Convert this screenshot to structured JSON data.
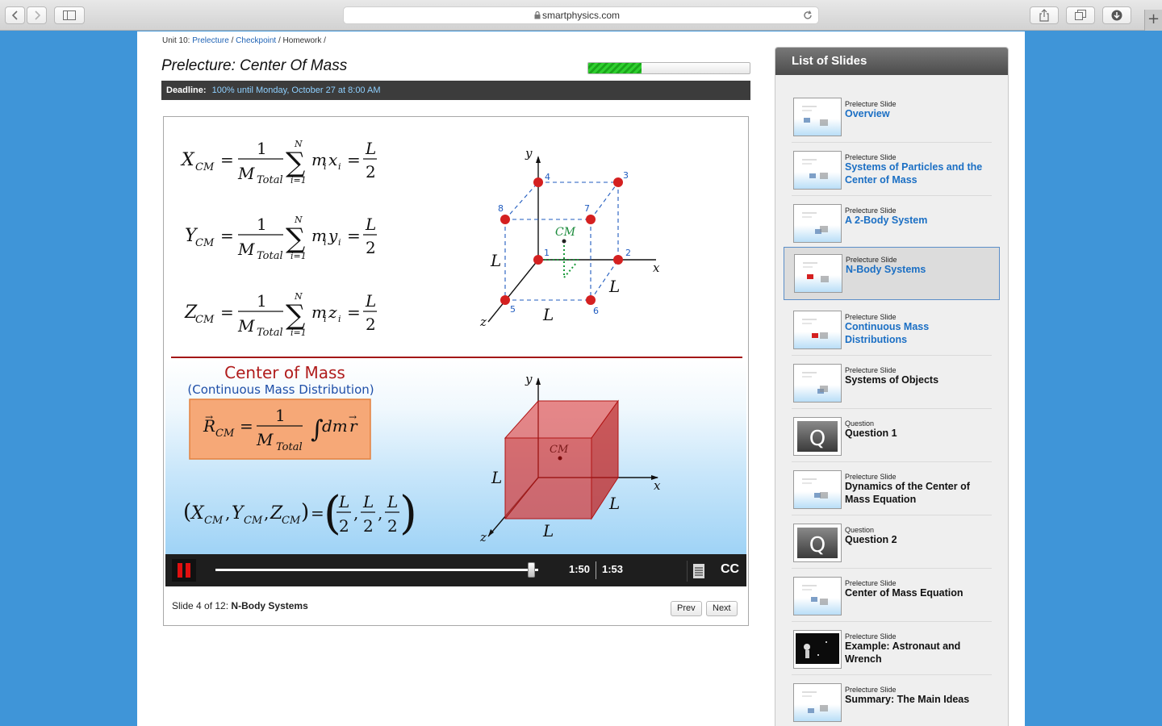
{
  "browser": {
    "url": "smartphysics.com"
  },
  "breadcrumb": {
    "unit": "Unit 10:",
    "prelecture": "Prelecture",
    "checkpoint": "Checkpoint",
    "homework": "Homework /",
    "sep": "/"
  },
  "page": {
    "title": "Prelecture: Center Of Mass",
    "progress_fraction": 0.33,
    "deadline_label": "Deadline:",
    "deadline_value": "100% until Monday, October 27 at 8:00 AM"
  },
  "slide": {
    "eq_top": [
      "X",
      "Y",
      "Z"
    ],
    "eq_top_sub": "CM",
    "eq_top_vars": [
      "x",
      "y",
      "z"
    ],
    "eq_one": "1",
    "eq_M": "M",
    "eq_Total": "Total",
    "eq_N": "N",
    "eq_i1": "i=1",
    "eq_m": "m",
    "eq_i": "i",
    "eq_L": "L",
    "eq_2": "2",
    "cube_vertices": [
      "1",
      "2",
      "3",
      "4",
      "5",
      "6",
      "7",
      "8"
    ],
    "axis_x": "x",
    "axis_y": "y",
    "axis_z": "z",
    "cm_label": "CM",
    "cm_title": "Center of Mass",
    "cm_subtitle": "(Continuous Mass Distribution)",
    "rcm_R": "R",
    "rcm_integral": "dm",
    "rcm_r": "r"
  },
  "player": {
    "time_current": "1:50",
    "time_total": "1:53",
    "position_fraction": 0.98,
    "cc_label": "CC"
  },
  "slide_info": {
    "prefix": "Slide 4 of 12:",
    "name": "N-Body Systems",
    "prev": "Prev",
    "next": "Next"
  },
  "slide_list": {
    "header": "List of Slides",
    "items": [
      {
        "kind": "Prelecture Slide",
        "title": "Overview",
        "style": "link",
        "thumb": "slide"
      },
      {
        "kind": "Prelecture Slide",
        "title": "Systems of Particles and the Center of Mass",
        "style": "link",
        "thumb": "slide"
      },
      {
        "kind": "Prelecture Slide",
        "title": "A 2-Body System",
        "style": "link",
        "thumb": "slide"
      },
      {
        "kind": "Prelecture Slide",
        "title": "N-Body Systems",
        "style": "link",
        "thumb": "slide",
        "active": true
      },
      {
        "kind": "Prelecture Slide",
        "title": "Continuous Mass Distributions",
        "style": "link",
        "thumb": "slide"
      },
      {
        "kind": "Prelecture Slide",
        "title": "Systems of Objects",
        "style": "plain",
        "thumb": "slide"
      },
      {
        "kind": "Question",
        "title": "Question 1",
        "style": "plain",
        "thumb": "question"
      },
      {
        "kind": "Prelecture Slide",
        "title": "Dynamics of the Center of Mass Equation",
        "style": "plain",
        "thumb": "slide"
      },
      {
        "kind": "Question",
        "title": "Question 2",
        "style": "plain",
        "thumb": "question"
      },
      {
        "kind": "Prelecture Slide",
        "title": "Center of Mass Equation",
        "style": "plain",
        "thumb": "slide"
      },
      {
        "kind": "Prelecture Slide",
        "title": "Example: Astronaut and Wrench",
        "style": "plain",
        "thumb": "dark"
      },
      {
        "kind": "Prelecture Slide",
        "title": "Summary: The Main Ideas",
        "style": "plain",
        "thumb": "slide"
      }
    ]
  },
  "colors": {
    "link": "#1b6fc4",
    "accent_red": "#b01c1c",
    "progress_green": "#2fcf2f"
  }
}
